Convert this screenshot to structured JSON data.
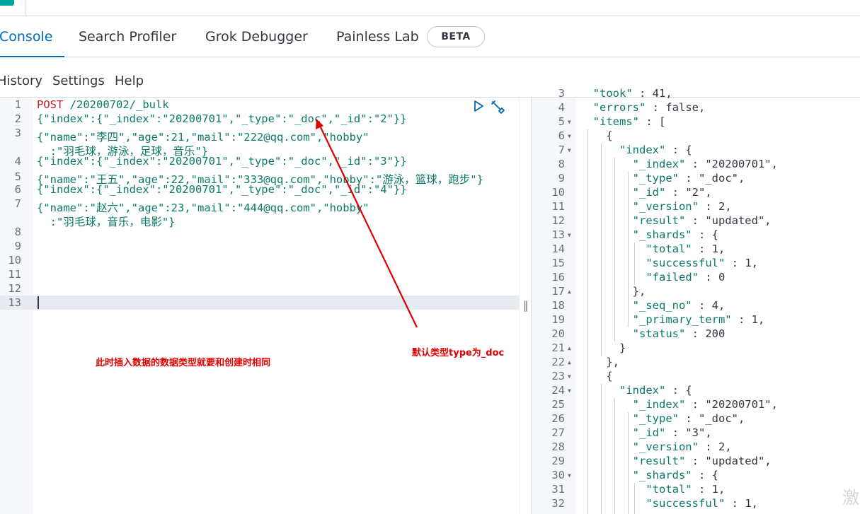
{
  "tabs": [
    {
      "label": "Console",
      "active": true
    },
    {
      "label": "Search Profiler",
      "active": false
    },
    {
      "label": "Grok Debugger",
      "active": false
    },
    {
      "label": "Painless Lab",
      "active": false
    }
  ],
  "beta_badge": "BETA",
  "menu": {
    "history": "History",
    "settings": "Settings",
    "help": "Help"
  },
  "request": {
    "line_numbers": [
      "1",
      "2",
      "3",
      "4",
      "5",
      "6",
      "7",
      "8",
      "9",
      "10",
      "11",
      "12",
      "13"
    ],
    "method": "POST",
    "url": "/20200702/_bulk",
    "lines": [
      "{\"index\":{\"_index\":\"20200701\",\"_type\":\"_doc\",\"_id\":\"2\"}}",
      "{\"name\":\"李四\",\"age\":21,\"mail\":\"222@qq.com\",\"hobby\"",
      "  :\"羽毛球，游泳，足球，音乐\"}",
      "{\"index\":{\"_index\":\"20200701\",\"_type\":\"_doc\",\"_id\":\"3\"}}",
      "{\"name\":\"王五\",\"age\":22,\"mail\":\"333@qq.com\",\"hobby\":\"游泳，篮球，跑步\"}",
      "{\"index\":{\"_index\":\"20200701\",\"_type\":\"_doc\",\"_id\":\"4\"}}",
      "{\"name\":\"赵六\",\"age\":23,\"mail\":\"444@qq.com\",\"hobby\"",
      "  :\"羽毛球，音乐，电影\"}"
    ]
  },
  "response": {
    "line_numbers": [
      "3",
      "4",
      "5",
      "6",
      "7",
      "8",
      "9",
      "10",
      "11",
      "12",
      "13",
      "14",
      "15",
      "16",
      "17",
      "18",
      "19",
      "20",
      "21",
      "22",
      "23",
      "24",
      "25",
      "26",
      "27",
      "28",
      "29",
      "30",
      "31",
      "32"
    ],
    "lines": [
      "  \"took\" : 41,",
      "  \"errors\" : false,",
      "  \"items\" : [",
      "    {",
      "      \"index\" : {",
      "        \"_index\" : \"20200701\",",
      "        \"_type\" : \"_doc\",",
      "        \"_id\" : \"2\",",
      "        \"_version\" : 2,",
      "        \"result\" : \"updated\",",
      "        \"_shards\" : {",
      "          \"total\" : 1,",
      "          \"successful\" : 1,",
      "          \"failed\" : 0",
      "        },",
      "        \"_seq_no\" : 4,",
      "        \"_primary_term\" : 1,",
      "        \"status\" : 200",
      "      }",
      "    },",
      "    {",
      "      \"index\" : {",
      "        \"_index\" : \"20200701\",",
      "        \"_type\" : \"_doc\",",
      "        \"_id\" : \"3\",",
      "        \"_version\" : 2,",
      "        \"result\" : \"updated\",",
      "        \"_shards\" : {",
      "          \"total\" : 1,",
      "          \"successful\" : 1,"
    ]
  },
  "annotations": {
    "left_note": "此时插入数据的数据类型就要和创建时相同",
    "right_note": "默认类型type为_doc"
  },
  "watermark": "激",
  "colors": {
    "accent": "#006bb8",
    "annotation": "#e00000",
    "string": "#0b7a66",
    "method": "#c61e25",
    "boolean": "#a31ddf"
  }
}
